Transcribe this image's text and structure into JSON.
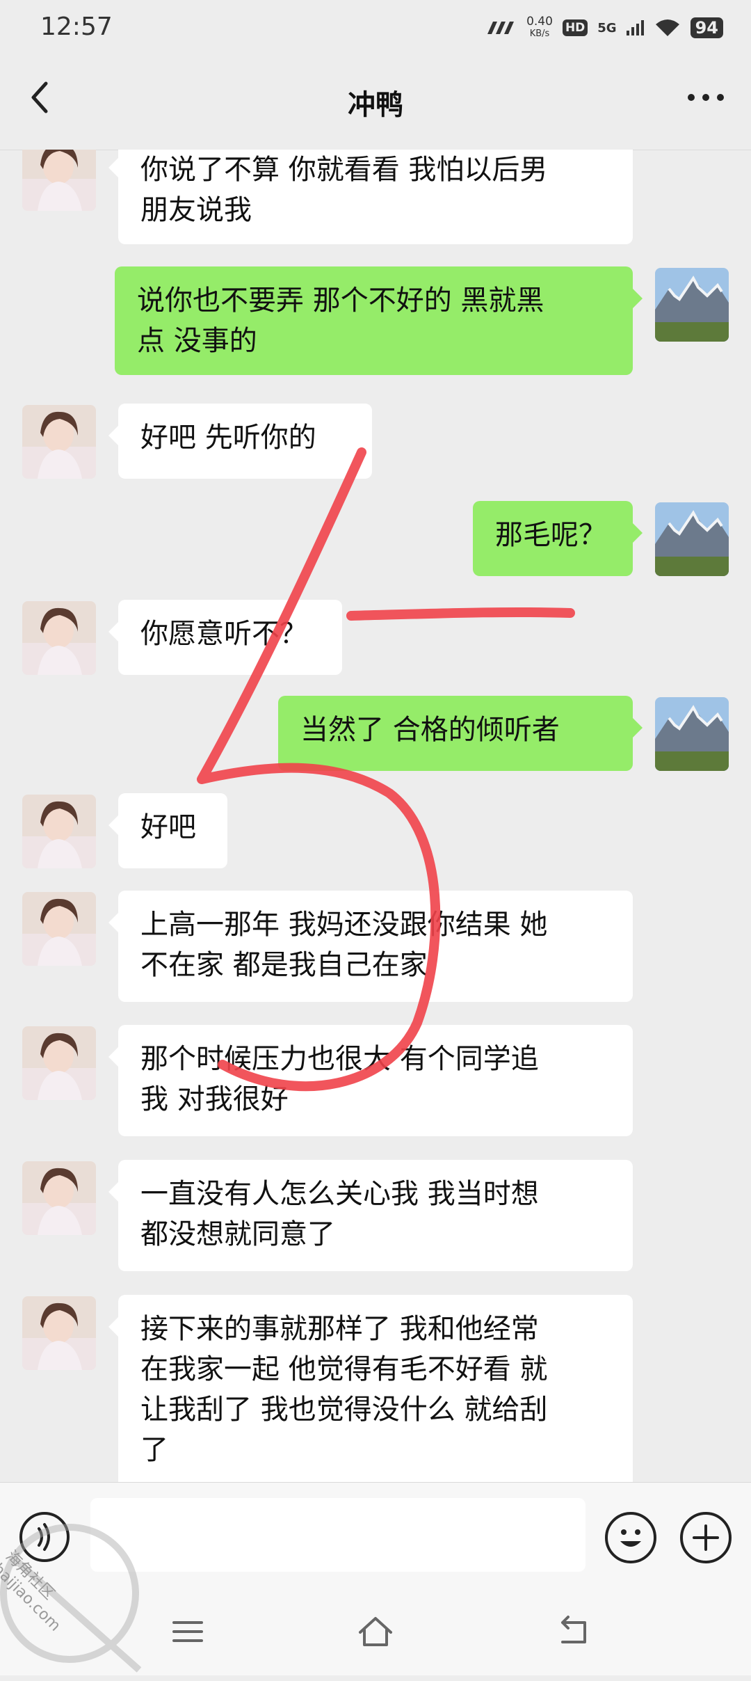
{
  "status_bar": {
    "time": "12:57",
    "net_speed_value": "0.40",
    "net_speed_unit": "KB/s",
    "hd": "HD",
    "network": "5G",
    "battery": "94"
  },
  "header": {
    "title": "冲鸭",
    "back_icon": "chevron-left-icon",
    "more_icon": "more-dots-icon"
  },
  "messages": [
    {
      "side": "in",
      "lines": [
        "你说了不算  你就看看  我怕以后男",
        "朋友说我"
      ]
    },
    {
      "side": "out",
      "lines": [
        "说你也不要弄  那个不好的  黑就黑",
        "点  没事的"
      ]
    },
    {
      "side": "in",
      "lines": [
        "好吧  先听你的"
      ]
    },
    {
      "side": "out",
      "lines": [
        "那毛呢？"
      ]
    },
    {
      "side": "in",
      "lines": [
        "你愿意听不？"
      ]
    },
    {
      "side": "out",
      "lines": [
        "当然了  合格的倾听者"
      ]
    },
    {
      "side": "in",
      "lines": [
        "好吧"
      ]
    },
    {
      "side": "in",
      "lines": [
        "上高一那年  我妈还没跟你结果  她",
        "不在家  都是我自己在家"
      ]
    },
    {
      "side": "in",
      "lines": [
        "那个时候压力也很大  有个同学追",
        "我  对我很好"
      ]
    },
    {
      "side": "in",
      "lines": [
        "一直没有人怎么关心我  我当时想",
        "都没想就同意了"
      ]
    },
    {
      "side": "in",
      "lines": [
        "接下来的事就那样了  我和他经常",
        "在我家一起  他觉得有毛不好看  就",
        "让我刮了  我也觉得没什么  就给刮",
        "了"
      ]
    }
  ],
  "input_bar": {
    "placeholder": "",
    "voice_icon": "voice-icon",
    "emoji_icon": "emoji-icon",
    "plus_icon": "plus-icon"
  },
  "nav_bar": {
    "menu_icon": "menu-icon",
    "home_icon": "home-icon",
    "back_icon": "back-icon"
  },
  "watermark": {
    "text": "haijiao.com",
    "text_cn": "海角社区"
  },
  "colors": {
    "background": "#ededed",
    "incoming_bubble": "#ffffff",
    "outgoing_bubble": "#95ec69",
    "annotation_stroke": "#f0434a"
  }
}
